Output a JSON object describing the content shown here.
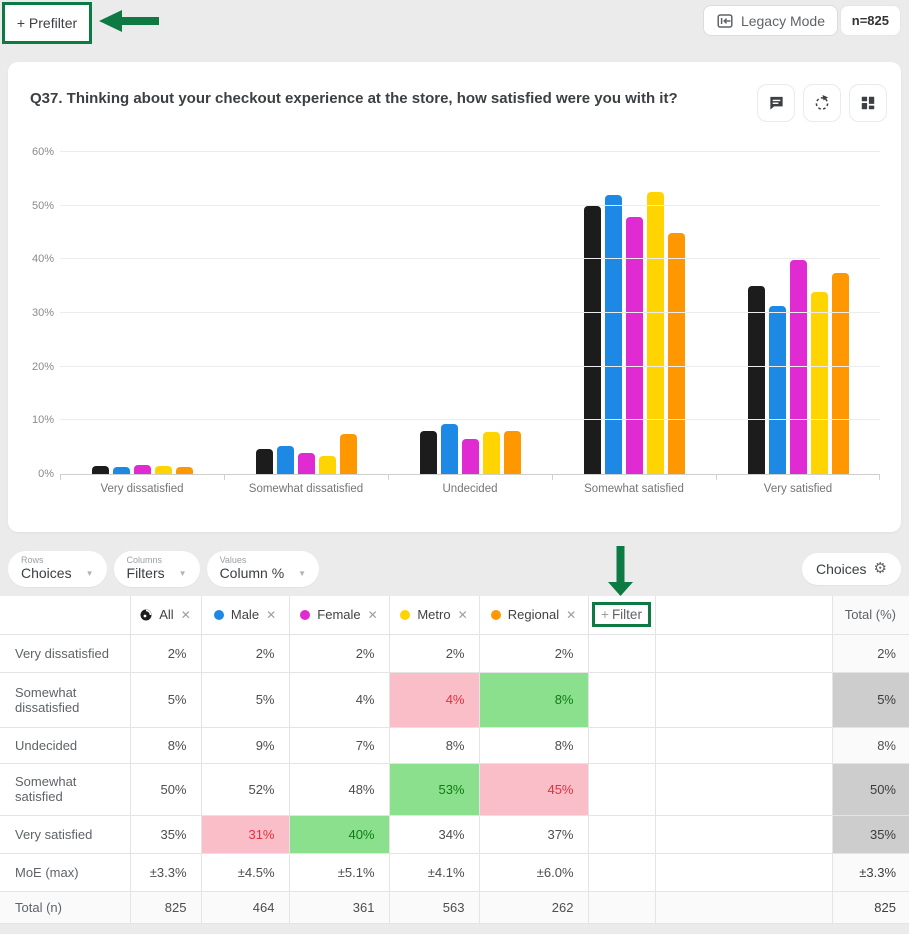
{
  "annotation": {
    "color": "#0d7a44"
  },
  "topbar": {
    "prefilter_label": "+ Prefilter",
    "legacy_label": "Legacy Mode",
    "n_label": "n=825"
  },
  "chart_card": {
    "title": "Q37. Thinking about your checkout experience at the store, how satisfied were you with it?",
    "icons": [
      "comment-icon",
      "rotate-refresh-icon",
      "dashboard-grid-icon"
    ]
  },
  "chart_data": {
    "type": "bar",
    "title": "Q37. Thinking about your checkout experience at the store, how satisfied were you with it?",
    "categories": [
      "Very dissatisfied",
      "Somewhat dissatisfied",
      "Undecided",
      "Somewhat satisfied",
      "Very satisfied"
    ],
    "series": [
      {
        "name": "All",
        "color": "#1c1c1c",
        "values": [
          1.5,
          4.7,
          8.0,
          50.0,
          35.0
        ]
      },
      {
        "name": "Male",
        "color": "#1e88e5",
        "values": [
          1.4,
          5.2,
          9.3,
          52.0,
          31.3
        ]
      },
      {
        "name": "Female",
        "color": "#e02bd3",
        "values": [
          1.6,
          4.0,
          6.5,
          47.8,
          39.8
        ]
      },
      {
        "name": "Metro",
        "color": "#ffd400",
        "values": [
          1.5,
          3.3,
          7.9,
          52.5,
          34.0
        ]
      },
      {
        "name": "Regional",
        "color": "#ff9800",
        "values": [
          1.4,
          7.4,
          8.1,
          45.0,
          37.5
        ]
      }
    ],
    "ylim": [
      0,
      60
    ],
    "yticks": [
      "0%",
      "10%",
      "20%",
      "30%",
      "40%",
      "50%",
      "60%"
    ],
    "grid": true,
    "legend": "none"
  },
  "controls": {
    "rows": {
      "label": "Rows",
      "value": "Choices"
    },
    "columns": {
      "label": "Columns",
      "value": "Filters"
    },
    "values": {
      "label": "Values",
      "value": "Column %"
    },
    "choices_label": "Choices"
  },
  "table": {
    "columns": [
      {
        "label": "All",
        "color": "#1c1c1c",
        "icon": "all-respondents-icon"
      },
      {
        "label": "Male",
        "color": "#1e88e5",
        "icon": "dot"
      },
      {
        "label": "Female",
        "color": "#e02bd3",
        "icon": "dot"
      },
      {
        "label": "Metro",
        "color": "#ffd400",
        "icon": "dot"
      },
      {
        "label": "Regional",
        "color": "#ff9800",
        "icon": "dot"
      }
    ],
    "add_filter_label": "+ Filter",
    "total_header": "Total (%)",
    "rows": [
      {
        "label": "Very dissatisfied",
        "values": [
          {
            "t": "2%"
          },
          {
            "t": "2%"
          },
          {
            "t": "2%"
          },
          {
            "t": "2%"
          },
          {
            "t": "2%"
          }
        ],
        "total": {
          "t": "2%",
          "gray": false,
          "bold": false
        }
      },
      {
        "label": "Somewhat dissatisfied",
        "values": [
          {
            "t": "5%"
          },
          {
            "t": "5%"
          },
          {
            "t": "4%"
          },
          {
            "t": "4%",
            "hl": "pink"
          },
          {
            "t": "8%",
            "hl": "green"
          }
        ],
        "total": {
          "t": "5%",
          "gray": true,
          "bold": true
        }
      },
      {
        "label": "Undecided",
        "values": [
          {
            "t": "8%"
          },
          {
            "t": "9%"
          },
          {
            "t": "7%"
          },
          {
            "t": "8%"
          },
          {
            "t": "8%"
          }
        ],
        "total": {
          "t": "8%",
          "gray": false,
          "bold": false
        }
      },
      {
        "label": "Somewhat satisfied",
        "values": [
          {
            "t": "50%"
          },
          {
            "t": "52%"
          },
          {
            "t": "48%"
          },
          {
            "t": "53%",
            "hl": "green"
          },
          {
            "t": "45%",
            "hl": "pink"
          }
        ],
        "total": {
          "t": "50%",
          "gray": true,
          "bold": true
        }
      },
      {
        "label": "Very satisfied",
        "values": [
          {
            "t": "35%"
          },
          {
            "t": "31%",
            "hl": "pink"
          },
          {
            "t": "40%",
            "hl": "green"
          },
          {
            "t": "34%"
          },
          {
            "t": "37%"
          }
        ],
        "total": {
          "t": "35%",
          "gray": true,
          "bold": true
        }
      },
      {
        "label": "MoE (max)",
        "values": [
          {
            "t": "±3.3%"
          },
          {
            "t": "±4.5%"
          },
          {
            "t": "±5.1%"
          },
          {
            "t": "±4.1%"
          },
          {
            "t": "±6.0%"
          }
        ],
        "total": {
          "t": "±3.3%",
          "gray": false,
          "bold": true
        }
      },
      {
        "label": "Total (n)",
        "values": [
          {
            "t": "825"
          },
          {
            "t": "464"
          },
          {
            "t": "361"
          },
          {
            "t": "563"
          },
          {
            "t": "262"
          }
        ],
        "total": {
          "t": "825",
          "gray": false,
          "bold": true
        }
      }
    ]
  }
}
